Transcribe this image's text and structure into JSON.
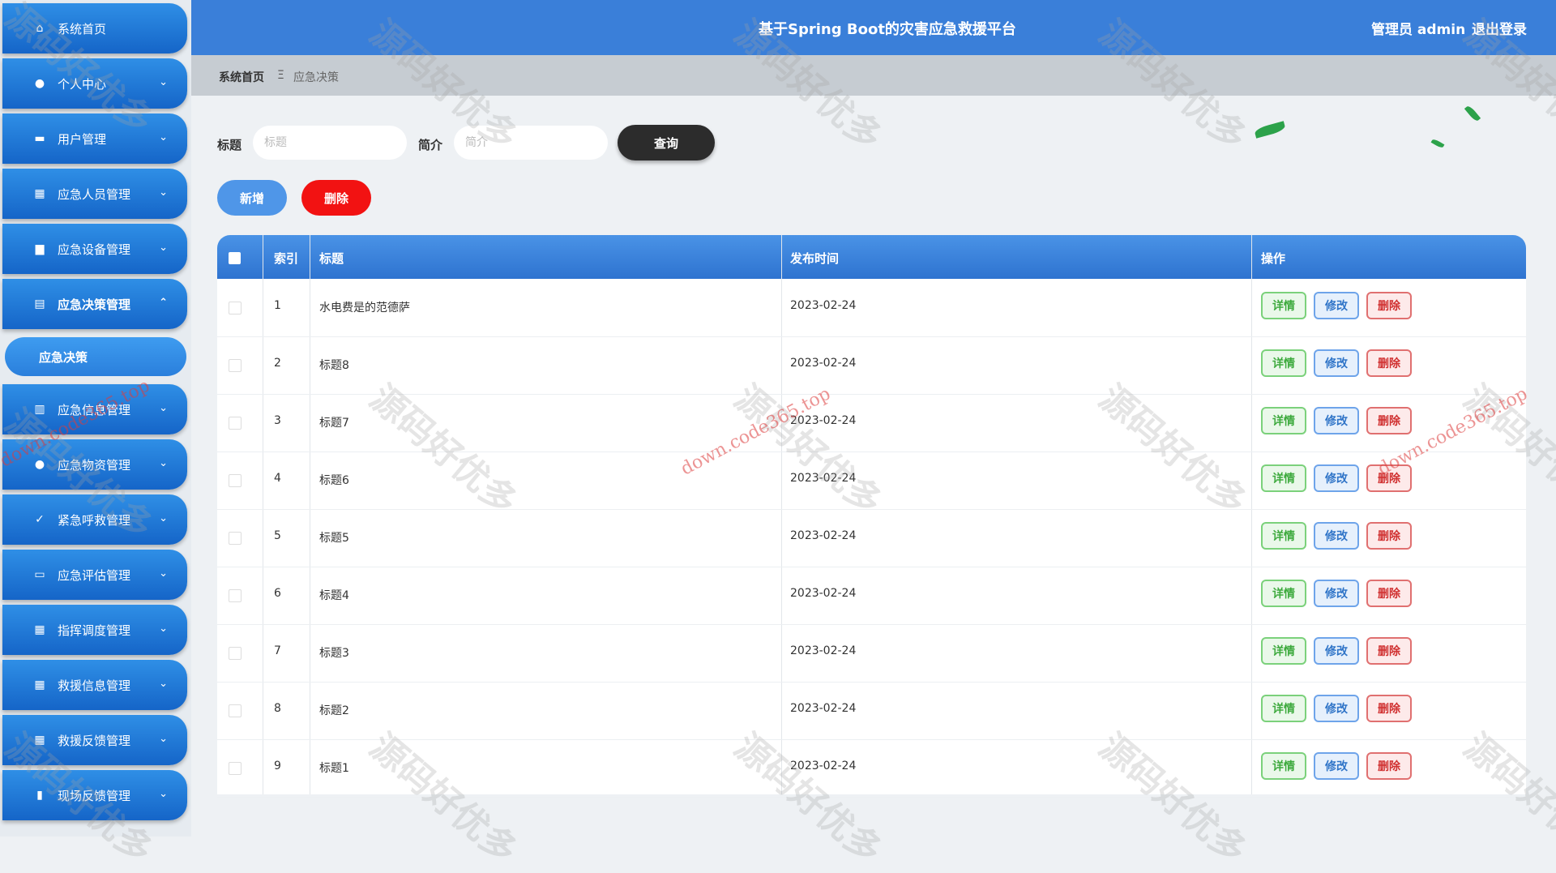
{
  "header": {
    "title": "基于Spring Boot的灾害应急救援平台",
    "user": "管理员 admin",
    "logout": "退出登录"
  },
  "sidebar": {
    "items": [
      {
        "label": "系统首页",
        "icon": "home-icon"
      },
      {
        "label": "个人中心",
        "icon": "user-icon"
      },
      {
        "label": "用户管理",
        "icon": "id-card-icon"
      },
      {
        "label": "应急人员管理",
        "icon": "grid-icon"
      },
      {
        "label": "应急设备管理",
        "icon": "briefcase-icon"
      },
      {
        "label": "应急决策管理",
        "icon": "clipboard-icon"
      },
      {
        "label": "应急信息管理",
        "icon": "info-icon"
      },
      {
        "label": "应急物资管理",
        "icon": "user-icon"
      },
      {
        "label": "紧急呼救管理",
        "icon": "check-icon"
      },
      {
        "label": "应急评估管理",
        "icon": "monitor-icon"
      },
      {
        "label": "指挥调度管理",
        "icon": "grid-icon"
      },
      {
        "label": "救援信息管理",
        "icon": "grid-icon"
      },
      {
        "label": "救援反馈管理",
        "icon": "grid-icon"
      },
      {
        "label": "现场反馈管理",
        "icon": "building-icon"
      }
    ],
    "submenu": "应急决策"
  },
  "breadcrumb": {
    "home": "系统首页",
    "sep": "Ξ",
    "current": "应急决策"
  },
  "search": {
    "title_label": "标题",
    "title_placeholder": "标题",
    "intro_label": "简介",
    "intro_placeholder": "简介",
    "query_btn": "查询"
  },
  "actions": {
    "add": "新增",
    "delete": "删除"
  },
  "table": {
    "columns": [
      "索引",
      "标题",
      "发布时间",
      "操作"
    ],
    "row_buttons": {
      "detail": "详情",
      "edit": "修改",
      "delete": "删除"
    },
    "rows": [
      {
        "index": "1",
        "title": "水电费是的范德萨",
        "date": "2023-02-24"
      },
      {
        "index": "2",
        "title": "标题8",
        "date": "2023-02-24"
      },
      {
        "index": "3",
        "title": "标题7",
        "date": "2023-02-24"
      },
      {
        "index": "4",
        "title": "标题6",
        "date": "2023-02-24"
      },
      {
        "index": "5",
        "title": "标题5",
        "date": "2023-02-24"
      },
      {
        "index": "6",
        "title": "标题4",
        "date": "2023-02-24"
      },
      {
        "index": "7",
        "title": "标题3",
        "date": "2023-02-24"
      },
      {
        "index": "8",
        "title": "标题2",
        "date": "2023-02-24"
      },
      {
        "index": "9",
        "title": "标题1",
        "date": "2023-02-24"
      }
    ]
  },
  "watermark": {
    "text": "源码好优多",
    "url": "down.code365.top"
  }
}
